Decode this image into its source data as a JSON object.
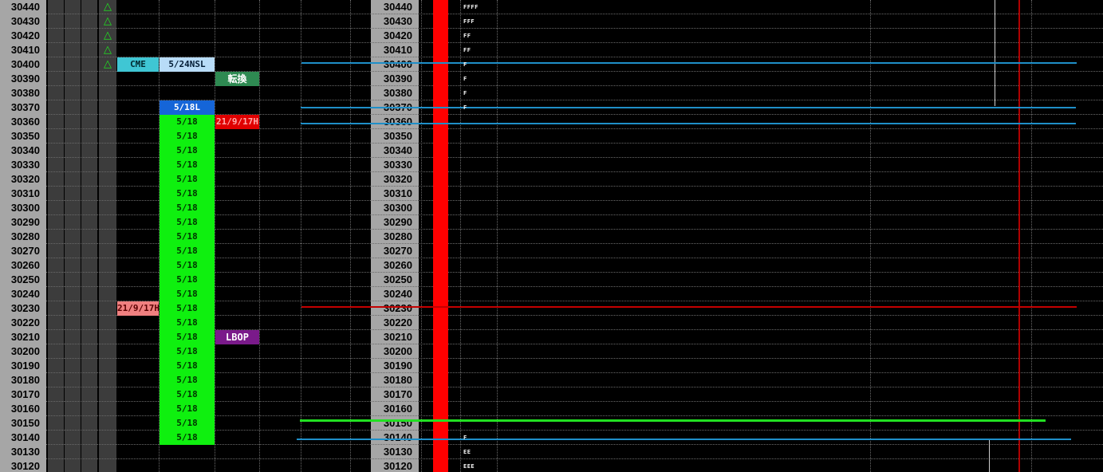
{
  "price_ladder": {
    "prices": [
      "30440",
      "30430",
      "30420",
      "30410",
      "30400",
      "30390",
      "30380",
      "30370",
      "30360",
      "30350",
      "30340",
      "30330",
      "30320",
      "30310",
      "30300",
      "30290",
      "30280",
      "30270",
      "30260",
      "30250",
      "30240",
      "30230",
      "30220",
      "30210",
      "30200",
      "30190",
      "30180",
      "30170",
      "30160",
      "30150",
      "30140",
      "30130",
      "30120"
    ]
  },
  "markers": {
    "triangle_glyph": "△",
    "triangle_rows": [
      0,
      1,
      2,
      3,
      4
    ],
    "color": "#21e021"
  },
  "labels": {
    "cme": {
      "text": "CME",
      "row": 4,
      "bg": "#3fc6d4",
      "fg": "#002a30"
    },
    "nsl": {
      "text": "5/24NSL",
      "row": 4,
      "bg": "#b8dcf8",
      "fg": "#001a33"
    },
    "tenkan": {
      "text": "転換",
      "row": 5,
      "bg": "#2e8a52",
      "fg": "#ffffff"
    },
    "l518": {
      "text": "5/18L",
      "row": 7,
      "bg": "#1565d8",
      "fg": "#ffffff"
    },
    "red_tag": {
      "text": "21/9/17H",
      "row": 8,
      "bg": "#e00000",
      "fg": "#ffaaaa"
    },
    "pink_tag": {
      "text": "21/9/17H",
      "row": 21,
      "bg": "#f08080",
      "fg": "#5a0000"
    },
    "lbop": {
      "text": "LBOP",
      "row": 23,
      "bg": "#7a1a8a",
      "fg": "#ffffff"
    }
  },
  "range_518": {
    "text": "5/18",
    "rows": [
      8,
      9,
      10,
      11,
      12,
      13,
      14,
      15,
      16,
      17,
      18,
      19,
      20,
      21,
      22,
      23,
      24,
      25,
      26,
      27,
      28,
      29,
      30
    ],
    "color": "#0ff00f"
  },
  "tpo_profile": [
    {
      "row": 0,
      "text": "FFFF"
    },
    {
      "row": 1,
      "text": "FFF"
    },
    {
      "row": 2,
      "text": "FF"
    },
    {
      "row": 3,
      "text": "FF"
    },
    {
      "row": 4,
      "text": "F"
    },
    {
      "row": 5,
      "text": "F"
    },
    {
      "row": 6,
      "text": "F"
    },
    {
      "row": 7,
      "text": "F"
    },
    {
      "row": 30,
      "text": "F"
    },
    {
      "row": 31,
      "text": "EE"
    },
    {
      "row": 32,
      "text": "EEE"
    }
  ],
  "level_colors": {
    "blue": "#1f8fc8",
    "red": "#c40000",
    "green": "#22e022",
    "red_bar": "#ff0000"
  }
}
